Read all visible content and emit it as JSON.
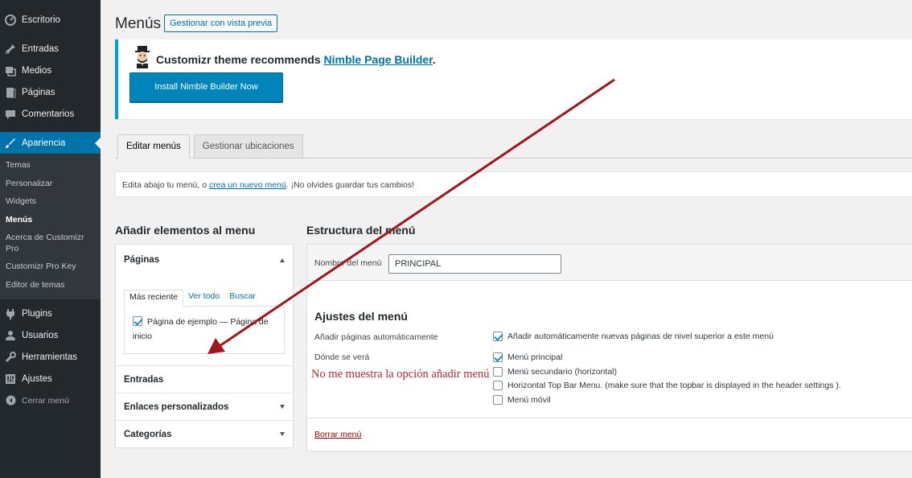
{
  "sidebar": {
    "items": [
      {
        "label": "Escritorio",
        "icon": "dashboard-icon"
      },
      {
        "label": "Entradas",
        "icon": "pin-icon"
      },
      {
        "label": "Medios",
        "icon": "media-icon"
      },
      {
        "label": "Páginas",
        "icon": "page-icon"
      },
      {
        "label": "Comentarios",
        "icon": "comment-icon"
      },
      {
        "label": "Apariencia",
        "icon": "brush-icon"
      }
    ],
    "submenu": [
      "Temas",
      "Personalizar",
      "Widgets",
      "Menús",
      "Acerca de Customizr Pro",
      "Customizr Pro Key",
      "Editor de temas"
    ],
    "items_after": [
      {
        "label": "Plugins",
        "icon": "plugin-icon"
      },
      {
        "label": "Usuarios",
        "icon": "users-icon"
      },
      {
        "label": "Herramientas",
        "icon": "wrench-icon"
      },
      {
        "label": "Ajustes",
        "icon": "settings-icon"
      }
    ],
    "collapse_label": "Cerrar menú"
  },
  "header": {
    "title": "Menús",
    "preview_button": "Gestionar con vista previa"
  },
  "notice": {
    "text": "Customizr theme recommends",
    "link": "Nimble Page Builder",
    "suffix": ".",
    "button": "Install Nimble Builder Now"
  },
  "tabs": [
    "Editar menús",
    "Gestionar ubicaciones"
  ],
  "manage": {
    "prefix": "Edita abajo tu menú, o",
    "link": "crea un nuevo menú",
    "suffix": ". ¡No olvides guardar tus cambios!"
  },
  "left": {
    "title": "Añadir elementos al menu",
    "pages_section": "Páginas",
    "pages_tabs": [
      "Más reciente",
      "Ver todo",
      "Buscar"
    ],
    "page_item": "Página de ejemplo — Página de inicio",
    "sections": [
      "Entradas",
      "Enlaces personalizados",
      "Categorías"
    ]
  },
  "right": {
    "title": "Estructura del menú",
    "name_label": "Nombre del menú",
    "name_value": "PRINCIPAL",
    "settings_title": "Ajustes del menú",
    "auto_label": "Añadir páginas automáticamente",
    "auto_option": "Añadir automáticamente nuevas páginas de nivel superior a este menú",
    "where_label": "Dónde se verá",
    "locations": [
      {
        "label": "Menú principal",
        "checked": true
      },
      {
        "label": "Menú secundario (horizontal)",
        "checked": false
      },
      {
        "label": "Horizontal Top Bar Menu. (make sure that the topbar is displayed in the header settings ).",
        "checked": false
      },
      {
        "label": "Menú móvil",
        "checked": false
      }
    ],
    "delete_link": "Borrar menú"
  },
  "annotation": {
    "text": "No me muestra la opción añadir menú",
    "color": "#b0282d"
  },
  "colors": {
    "sidebar_bg": "#23282d",
    "active_blue": "#0073aa",
    "button_blue": "#0085ba"
  }
}
